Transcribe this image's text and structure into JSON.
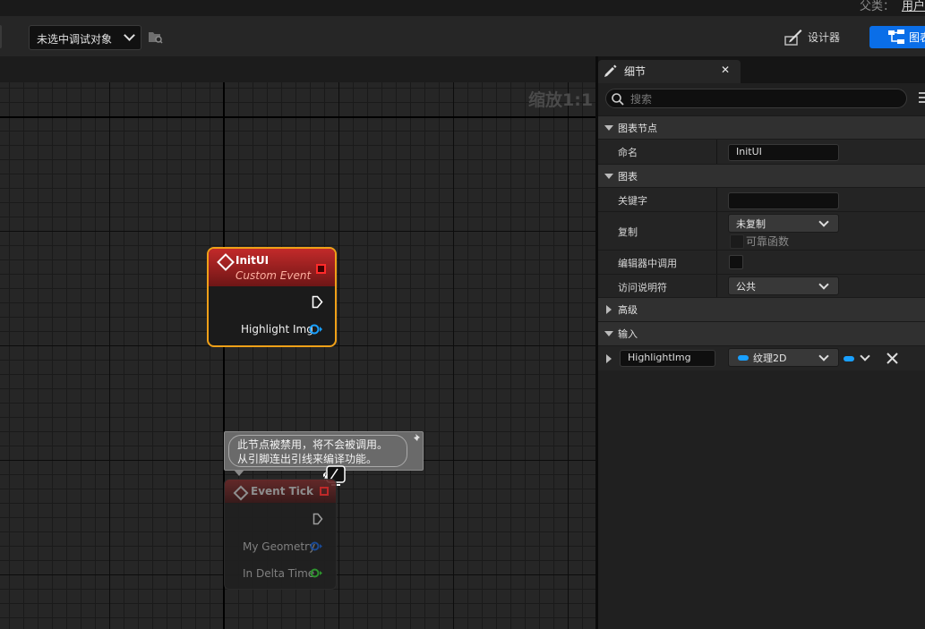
{
  "header": {
    "parent_class_label": "父类：",
    "parent_class_value": "用户"
  },
  "toolbar": {
    "debug_object": "未选中调试对象",
    "designer_label": "设计器",
    "graph_label": "图表"
  },
  "graph": {
    "zoom_label": "缩放1:1",
    "init_node": {
      "title": "InitUI",
      "subtitle": "Custom Event",
      "pin_label": "Highlight Img"
    },
    "comment": {
      "line1": "此节点被禁用，将不会被调用。",
      "line2": "从引脚连出引线来编译功能。"
    },
    "tick_node": {
      "title": "Event Tick",
      "pin1": "My Geometry",
      "pin2": "In Delta Time"
    }
  },
  "details": {
    "tab_title": "细节",
    "tab_close": "✕",
    "search_placeholder": "搜索",
    "sections": {
      "graph_node": "图表节点",
      "graph": "图表",
      "advanced": "高级",
      "inputs": "输入"
    },
    "fields": {
      "name_label": "命名",
      "name_value": "InitUI",
      "keywords_label": "关键字",
      "keywords_value": "",
      "replicate_label": "复制",
      "replicate_value": "未复制",
      "reliable_label": "可靠函数",
      "call_in_editor_label": "编辑器中调用",
      "access_label": "访问说明符",
      "access_value": "公共"
    },
    "input": {
      "name": "HighlightImg",
      "type": "纹理2D"
    }
  },
  "colors": {
    "accent": "#0a6ee8",
    "node_selected": "#f0a018",
    "event_header": "#c22a2a",
    "object_pin": "#19a0ff",
    "float_pin": "#2fc02f"
  }
}
